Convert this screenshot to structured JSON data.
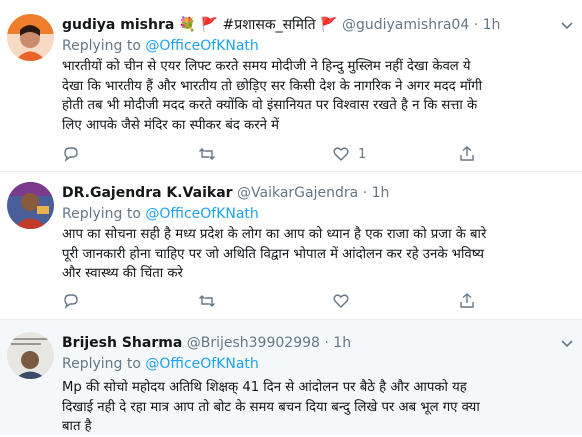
{
  "tweets": [
    {
      "name": "gudiya mishra",
      "badges": "💐 🚩 #प्रशासक_समिति 🚩",
      "handle": "@gudiyamishra04",
      "dot": "·",
      "time": "1h",
      "replying_prefix": "Replying to",
      "replying_to": "@OfficeOfKNath",
      "lines": [
        "भारतीयों को चीन से एयर लिफ्ट करते समय मोदीजी ने हिन्दु मुस्लिम नहीं देखा केवल ये",
        "देखा कि भारतीय हैं और भारतीय तो छोड़िए सर किसी देश के नागरिक ने अगर मदद माँगी",
        "होती तब भी मोदीजी मदद करते क्योंकि वो इंसानियत पर विश्वास रखते है न कि सत्ता के",
        "लिए आपके जैसे मंदिर का स्पीकर बंद करने में"
      ],
      "likes": "1"
    },
    {
      "name": "DR.Gajendra K.Vaikar",
      "handle": "@VaikarGajendra",
      "dot": "·",
      "time": "1h",
      "replying_prefix": "Replying to",
      "replying_to": "@OfficeOfKNath",
      "lines": [
        "आप का सोचना सही है मध्य प्रदेश के लोग का आप को ध्यान है एक राजा को प्रजा के बारे",
        "पूरी जानकारी होना चाहिए पर जो अथिति विद्वान भोपाल में आंदोलन कर रहे उनके भविष्य",
        "और स्वास्थ्य की चिंता करे"
      ]
    },
    {
      "name": "Brijesh Sharma",
      "handle": "@Brijesh39902998",
      "dot": "·",
      "time": "1h",
      "replying_prefix": "Replying to",
      "replying_to": "@OfficeOfKNath",
      "lines": [
        "Mp की सोचो महोदय अतिथि शिक्षक् 41 दिन से आंदोलन पर बैठे है और आपको यह",
        "दिखाई नही दे रहा मात्र आप तो  बोट के समय बचन दिया बन्दु लिखे पर अब भूल गए क्या",
        "बात है"
      ]
    }
  ],
  "icons": {
    "more": "chevron-down-icon",
    "reply": "reply-icon",
    "retweet": "retweet-icon",
    "like": "heart-icon",
    "share": "share-icon"
  },
  "colors": {
    "link": "#1da1f2",
    "secondary": "#657786",
    "divider": "#e6ecf0",
    "highlight_bg": "#f5f8fa"
  }
}
